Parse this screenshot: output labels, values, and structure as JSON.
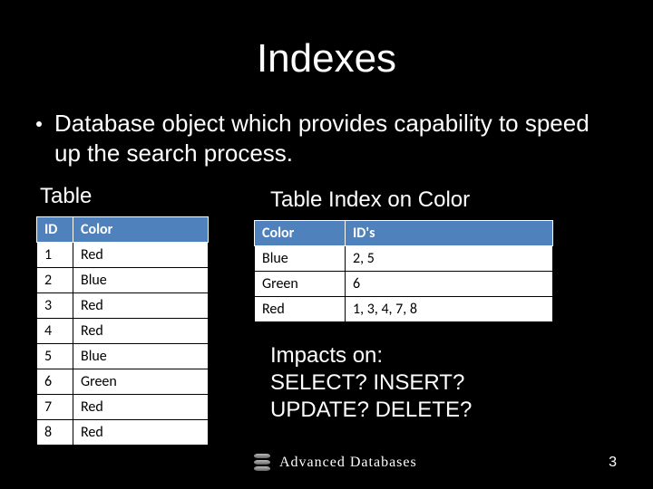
{
  "title": "Indexes",
  "bullet": "Database object which provides capability to speed up the search process.",
  "left_table": {
    "label": "Table",
    "headers": [
      "ID",
      "Color"
    ],
    "rows": [
      [
        "1",
        "Red"
      ],
      [
        "2",
        "Blue"
      ],
      [
        "3",
        "Red"
      ],
      [
        "4",
        "Red"
      ],
      [
        "5",
        "Blue"
      ],
      [
        "6",
        "Green"
      ],
      [
        "7",
        "Red"
      ],
      [
        "8",
        "Red"
      ]
    ]
  },
  "right_table": {
    "label": "Table Index on Color",
    "headers": [
      "Color",
      "ID's"
    ],
    "rows": [
      [
        "Blue",
        "2, 5"
      ],
      [
        "Green",
        "6"
      ],
      [
        "Red",
        "1, 3, 4, 7, 8"
      ]
    ]
  },
  "impacts": {
    "line1": "Impacts on:",
    "line2": "SELECT? INSERT?",
    "line3": "UPDATE? DELETE?"
  },
  "footer": {
    "text": "Advanced Databases",
    "page": "3"
  }
}
